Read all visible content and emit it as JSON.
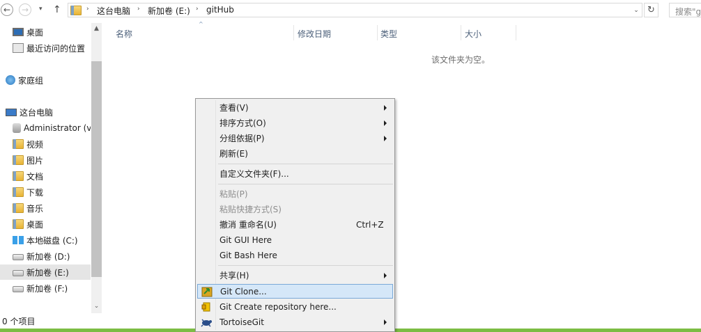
{
  "toolbar": {
    "back_glyph": "←",
    "forward_glyph": "→",
    "recent_glyph": "▾",
    "up_glyph": "↑",
    "refresh_glyph": "↻",
    "search_placeholder": "搜索\"g"
  },
  "address": {
    "sep": "›",
    "segments": [
      "这台电脑",
      "新加卷 (E:)",
      "gitHub"
    ],
    "dropdown_glyph": "⌄"
  },
  "nav": {
    "favorites": [
      {
        "label": "桌面",
        "icon": "desktop-icon"
      },
      {
        "label": "最近访问的位置",
        "icon": "recent-places-icon"
      }
    ],
    "homegroup": {
      "label": "家庭组",
      "icon": "homegroup-icon"
    },
    "thispc": {
      "label": "这台电脑",
      "icon": "computer-icon"
    },
    "pc_items": [
      {
        "label": "Administrator (v",
        "icon": "user-folder-icon"
      },
      {
        "label": "视频",
        "icon": "folder-icon"
      },
      {
        "label": "图片",
        "icon": "folder-icon"
      },
      {
        "label": "文档",
        "icon": "folder-icon"
      },
      {
        "label": "下载",
        "icon": "folder-icon"
      },
      {
        "label": "音乐",
        "icon": "folder-icon"
      },
      {
        "label": "桌面",
        "icon": "folder-icon"
      },
      {
        "label": "本地磁盘 (C:)",
        "icon": "windows-drive-icon"
      },
      {
        "label": "新加卷 (D:)",
        "icon": "drive-icon"
      },
      {
        "label": "新加卷 (E:)",
        "icon": "drive-icon",
        "selected": true
      },
      {
        "label": "新加卷 (F:)",
        "icon": "drive-icon"
      }
    ],
    "scroll_up_glyph": "▲",
    "scroll_down_glyph": "⌄"
  },
  "columns": {
    "name": "名称",
    "modified": "修改日期",
    "type": "类型",
    "size": "大小",
    "sort_glyph": "^"
  },
  "empty_message": "该文件夹为空。",
  "status": {
    "count": "0 个项目"
  },
  "context_menu": {
    "view": "查看(V)",
    "sort": "排序方式(O)",
    "group": "分组依据(P)",
    "refresh": "刷新(E)",
    "customize": "自定义文件夹(F)...",
    "paste": "粘贴(P)",
    "paste_shortcut": "粘贴快捷方式(S)",
    "undo": "撤消 重命名(U)",
    "undo_shortcut": "Ctrl+Z",
    "git_gui": "Git GUI Here",
    "git_bash": "Git Bash Here",
    "share": "共享(H)",
    "git_clone": "Git Clone...",
    "git_create": "Git Create repository here...",
    "tortoise": "TortoiseGit"
  },
  "colors": {
    "accent_highlight": "#d5e7f8",
    "status_line": "#7cbc44",
    "header_text": "#4c607a"
  }
}
